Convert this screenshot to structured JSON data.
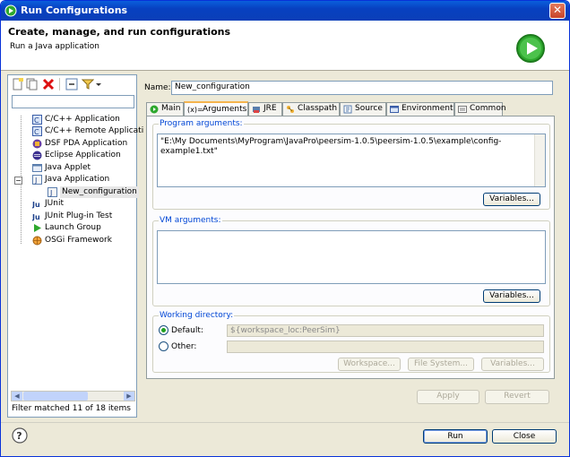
{
  "window": {
    "title": "Run Configurations"
  },
  "header": {
    "title": "Create, manage, and run configurations",
    "subtitle": "Run a Java application"
  },
  "left_panel": {
    "filter_value": "",
    "tree": [
      {
        "label": "C/C++ Application",
        "icon": "c-app-icon",
        "depth": 1
      },
      {
        "label": "C/C++ Remote Applicati",
        "icon": "c-app-icon",
        "depth": 1
      },
      {
        "label": "DSF PDA Application",
        "icon": "dsf-icon",
        "depth": 1
      },
      {
        "label": "Eclipse Application",
        "icon": "eclipse-icon",
        "depth": 1
      },
      {
        "label": "Java Applet",
        "icon": "applet-icon",
        "depth": 1
      },
      {
        "label": "Java Application",
        "icon": "java-app-icon",
        "depth": 1,
        "expanded": true
      },
      {
        "label": "New_configuration",
        "icon": "java-config-icon",
        "depth": 2,
        "selected": true
      },
      {
        "label": "JUnit",
        "icon": "junit-icon",
        "depth": 1
      },
      {
        "label": "JUnit Plug-in Test",
        "icon": "junit-plugin-icon",
        "depth": 1
      },
      {
        "label": "Launch Group",
        "icon": "launch-group-icon",
        "depth": 1
      },
      {
        "label": "OSGi Framework",
        "icon": "osgi-icon",
        "depth": 1
      }
    ],
    "filter_status": "Filter matched 11 of 18 items"
  },
  "right_panel": {
    "name_label": "Name:",
    "name_value": "New_configuration",
    "tabs": [
      {
        "label": "Main",
        "icon": "main-tab-icon"
      },
      {
        "label": "Arguments",
        "icon": "arguments-tab-icon",
        "active": true,
        "prefix": "(x)="
      },
      {
        "label": "JRE",
        "icon": "jre-tab-icon"
      },
      {
        "label": "Classpath",
        "icon": "classpath-tab-icon"
      },
      {
        "label": "Source",
        "icon": "source-tab-icon"
      },
      {
        "label": "Environment",
        "icon": "environment-tab-icon"
      },
      {
        "label": "Common",
        "icon": "common-tab-icon"
      }
    ],
    "program_arguments": {
      "label": "Program arguments:",
      "value": "\"E:\\My Documents\\MyProgram\\JavaPro\\peersim-1.0.5\\peersim-1.0.5\\example\\config-example1.txt\"",
      "line1": "\"E:\\My Documents\\MyProgram\\JavaPro\\peersim-1.0.5\\peersim-1.0.5\\example\\config-",
      "line2": "example1.txt\"",
      "variables_button": "Variables..."
    },
    "vm_arguments": {
      "label": "VM arguments:",
      "value": "",
      "variables_button": "Variables..."
    },
    "working_directory": {
      "label": "Working directory:",
      "default_label": "Default:",
      "default_value": "${workspace_loc:PeerSim}",
      "other_label": "Other:",
      "other_value": "",
      "workspace_button": "Workspace...",
      "filesystem_button": "File System...",
      "variables_button": "Variables..."
    },
    "apply_button": "Apply",
    "revert_button": "Revert"
  },
  "footer": {
    "run_button": "Run",
    "close_button": "Close"
  },
  "colors": {
    "title_bar": "#0a4fd0",
    "group_label": "#0046d5",
    "radio_selected": "#21a121",
    "run_graphic": "#2ea82e"
  }
}
